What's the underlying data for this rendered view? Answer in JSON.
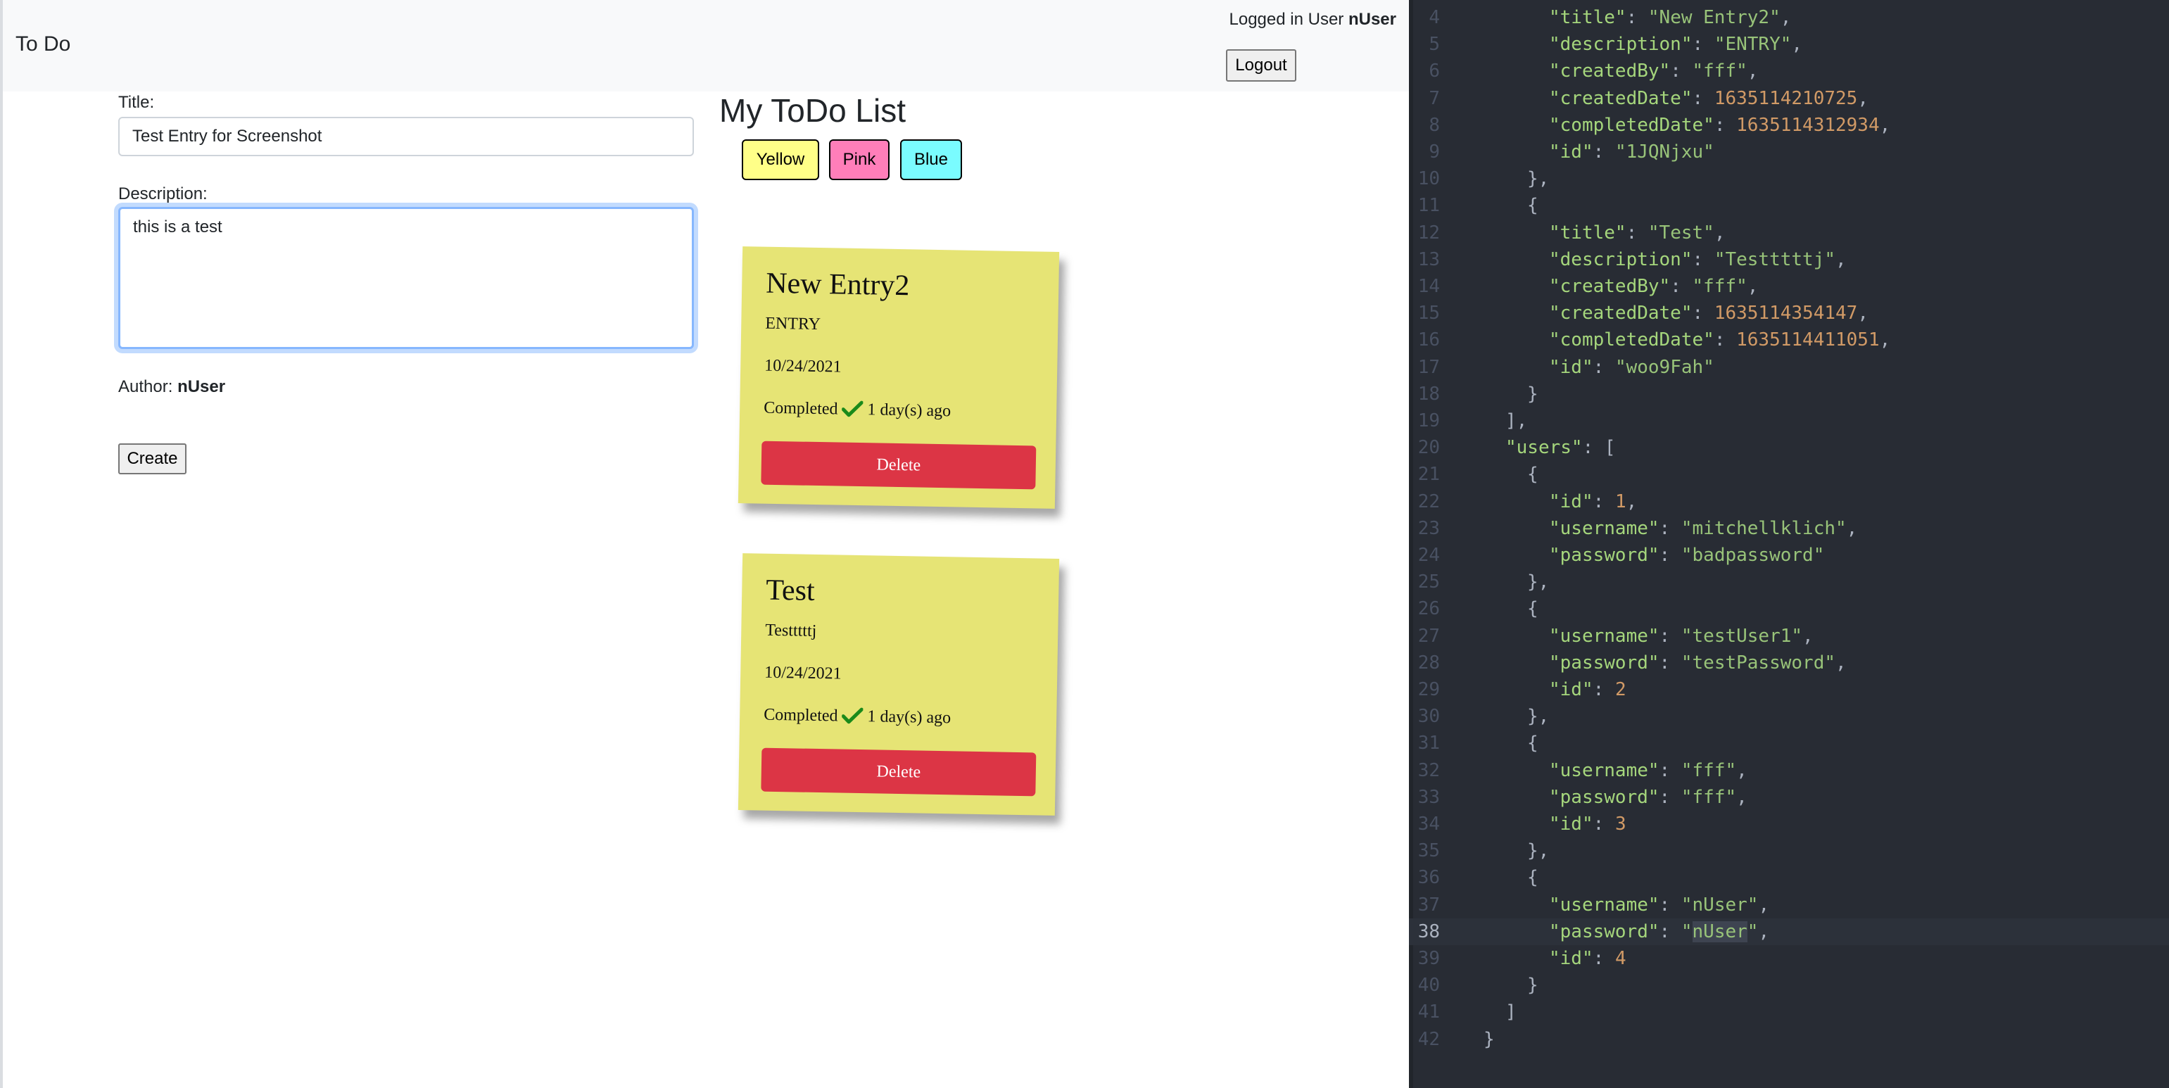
{
  "app": {
    "brand": "To Do",
    "login_prefix": "Logged in User",
    "login_user": "nUser",
    "logout_label": "Logout"
  },
  "form": {
    "title_label": "Title:",
    "title_value": "Test Entry for Screenshot",
    "description_label": "Description:",
    "description_value": "this is a test ",
    "author_label": "Author:",
    "author_value": "nUser",
    "create_label": "Create"
  },
  "list": {
    "heading": "My ToDo List",
    "color_buttons": [
      {
        "label": "Yellow",
        "color": "#ffff88"
      },
      {
        "label": "Pink",
        "color": "#ff7eb9"
      },
      {
        "label": "Blue",
        "color": "#7afcff"
      }
    ],
    "note_color": "#e6e475",
    "todos": [
      {
        "title": "New Entry2",
        "description": "ENTRY",
        "date": "10/24/2021",
        "status": "Completed",
        "completed_ago": "1 day(s) ago",
        "delete_label": "Delete"
      },
      {
        "title": "Test",
        "description": "Testttttj",
        "date": "10/24/2021",
        "status": "Completed",
        "completed_ago": "1 day(s) ago",
        "delete_label": "Delete"
      }
    ]
  },
  "editor": {
    "active_line": 38,
    "lines": [
      {
        "n": "4",
        "code": "\"title\": \"New Entry2\","
      },
      {
        "n": "5",
        "code": "\"description\": \"ENTRY\","
      },
      {
        "n": "6",
        "code": "\"createdBy\": \"fff\","
      },
      {
        "n": "7",
        "code": "\"createdDate\": 1635114210725,"
      },
      {
        "n": "8",
        "code": "\"completedDate\": 1635114312934,"
      },
      {
        "n": "9",
        "code": "\"id\": \"1JQNjxu\""
      },
      {
        "n": "10",
        "code": "},"
      },
      {
        "n": "11",
        "code": "{"
      },
      {
        "n": "12",
        "code": "\"title\": \"Test\","
      },
      {
        "n": "13",
        "code": "\"description\": \"Testttttj\","
      },
      {
        "n": "14",
        "code": "\"createdBy\": \"fff\","
      },
      {
        "n": "15",
        "code": "\"createdDate\": 1635114354147,"
      },
      {
        "n": "16",
        "code": "\"completedDate\": 1635114411051,"
      },
      {
        "n": "17",
        "code": "\"id\": \"woo9Fah\""
      },
      {
        "n": "18",
        "code": "}"
      },
      {
        "n": "19",
        "code": "],"
      },
      {
        "n": "20",
        "code": "\"users\": ["
      },
      {
        "n": "21",
        "code": "{"
      },
      {
        "n": "22",
        "code": "\"id\": 1,"
      },
      {
        "n": "23",
        "code": "\"username\": \"mitchellklich\","
      },
      {
        "n": "24",
        "code": "\"password\": \"badpassword\""
      },
      {
        "n": "25",
        "code": "},"
      },
      {
        "n": "26",
        "code": "{"
      },
      {
        "n": "27",
        "code": "\"username\": \"testUser1\","
      },
      {
        "n": "28",
        "code": "\"password\": \"testPassword\","
      },
      {
        "n": "29",
        "code": "\"id\": 2"
      },
      {
        "n": "30",
        "code": "},"
      },
      {
        "n": "31",
        "code": "{"
      },
      {
        "n": "32",
        "code": "\"username\": \"fff\","
      },
      {
        "n": "33",
        "code": "\"password\": \"fff\","
      },
      {
        "n": "34",
        "code": "\"id\": 3"
      },
      {
        "n": "35",
        "code": "},"
      },
      {
        "n": "36",
        "code": "{"
      },
      {
        "n": "37",
        "code": "\"username\": \"nUser\","
      },
      {
        "n": "38",
        "code": "\"password\": \"nUser\","
      },
      {
        "n": "39",
        "code": "\"id\": 4"
      },
      {
        "n": "40",
        "code": "}"
      },
      {
        "n": "41",
        "code": "]"
      },
      {
        "n": "42",
        "code": "}"
      }
    ]
  }
}
